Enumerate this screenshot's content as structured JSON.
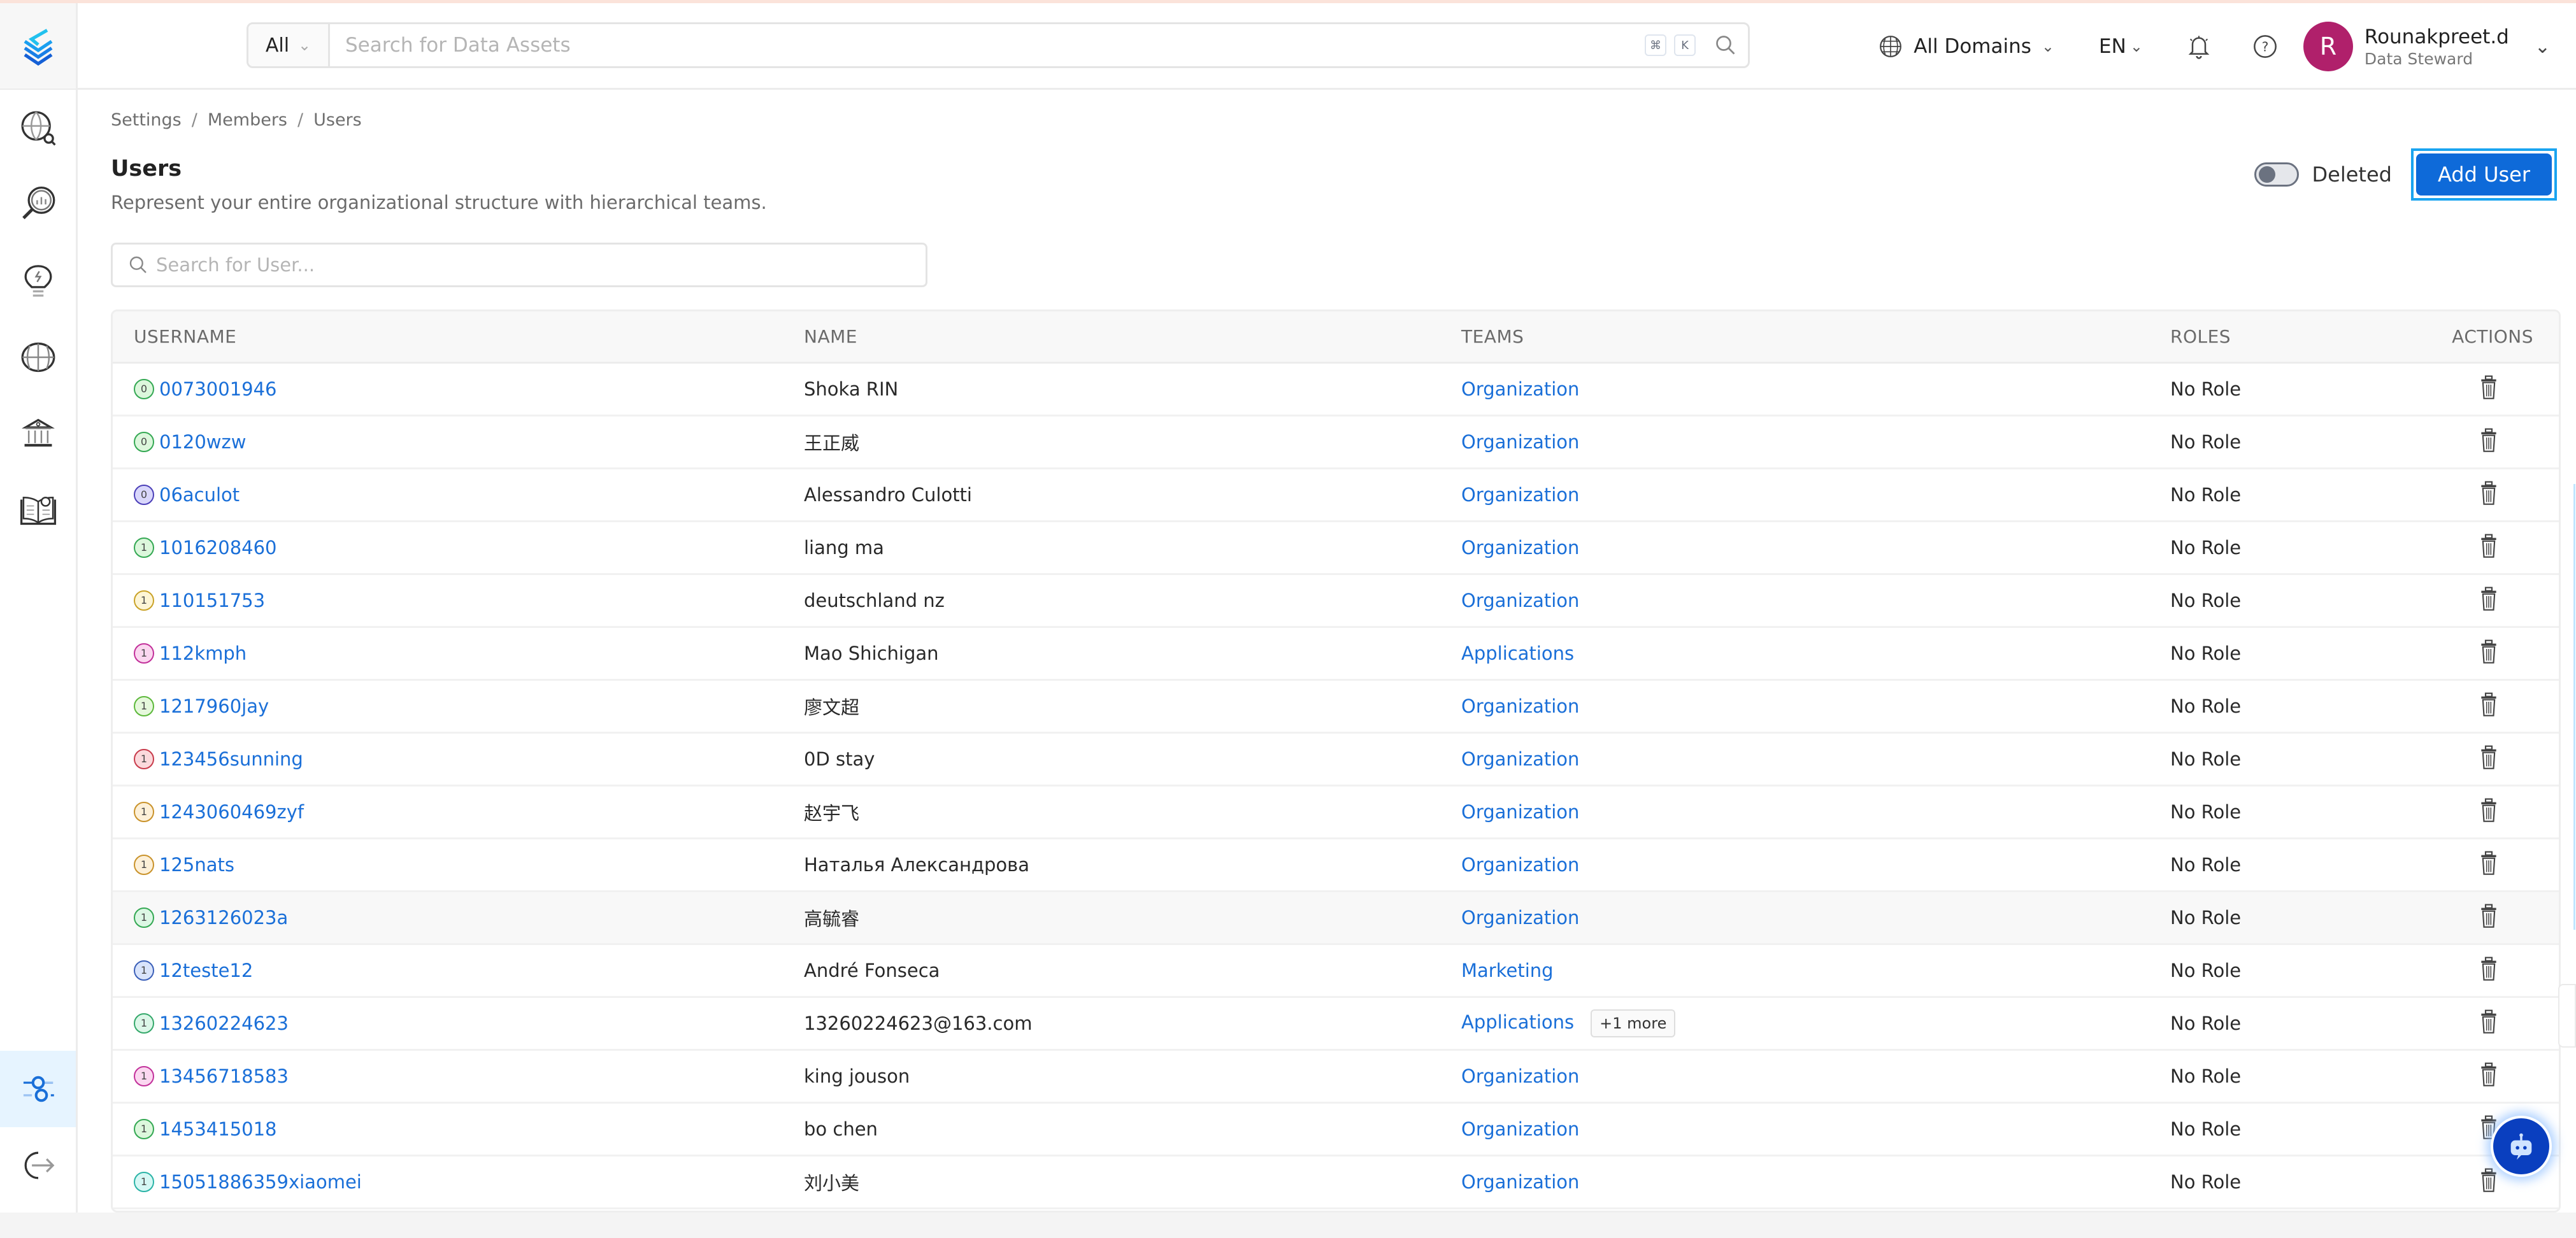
{
  "header": {
    "search_scope": "All",
    "search_placeholder": "Search for Data Assets",
    "shortcut_keys": [
      "⌘",
      "K"
    ],
    "domain_selector": "All Domains",
    "language": "EN",
    "user": {
      "initial": "R",
      "name": "Rounakpreet.d",
      "role": "Data Steward",
      "avatar_color": "#b0206b"
    }
  },
  "sidebar": {
    "items": [
      {
        "icon": "explore-icon",
        "label": "Explore"
      },
      {
        "icon": "data-insights-icon",
        "label": "Observability"
      },
      {
        "icon": "insights-lightbulb-icon",
        "label": "Insights"
      },
      {
        "icon": "domains-globe-icon",
        "label": "Domains"
      },
      {
        "icon": "governance-icon",
        "label": "Govern"
      },
      {
        "icon": "knowledge-book-icon",
        "label": "Knowledge"
      }
    ],
    "bottom_items": [
      {
        "icon": "settings-sliders-icon",
        "label": "Settings",
        "active": true
      },
      {
        "icon": "logout-icon",
        "label": "Logout"
      }
    ]
  },
  "breadcrumb": [
    "Settings",
    "Members",
    "Users"
  ],
  "page": {
    "title": "Users",
    "description": "Represent your entire organizational structure with hierarchical teams.",
    "deleted_toggle_label": "Deleted",
    "deleted_toggle_on": false,
    "add_button": "Add User",
    "user_search_placeholder": "Search for User..."
  },
  "table": {
    "columns": [
      "USERNAME",
      "NAME",
      "TEAMS",
      "ROLES",
      "ACTIONS"
    ],
    "rows": [
      {
        "badge": "0",
        "badge_color": "#34a853",
        "badge_bg": "#dcf7dc",
        "username": "0073001946",
        "name": "Shoka RIN",
        "team": "Organization",
        "more": "",
        "role": "No Role"
      },
      {
        "badge": "0",
        "badge_color": "#34a853",
        "badge_bg": "#dcf7dc",
        "username": "0120wzw",
        "name": "王正威",
        "team": "Organization",
        "more": "",
        "role": "No Role"
      },
      {
        "badge": "0",
        "badge_color": "#4b3fb8",
        "badge_bg": "#d9d7fb",
        "username": "06aculot",
        "name": "Alessandro Culotti",
        "team": "Organization",
        "more": "",
        "role": "No Role"
      },
      {
        "badge": "1",
        "badge_color": "#34a853",
        "badge_bg": "#dcf7dc",
        "username": "1016208460",
        "name": "liang ma",
        "team": "Organization",
        "more": "",
        "role": "No Role"
      },
      {
        "badge": "1",
        "badge_color": "#c9a227",
        "badge_bg": "#fdf5d6",
        "username": "110151753",
        "name": "deutschland nz",
        "team": "Organization",
        "more": "",
        "role": "No Role"
      },
      {
        "badge": "1",
        "badge_color": "#c2309a",
        "badge_bg": "#fbd7f0",
        "username": "112kmph",
        "name": "Mao Shichigan",
        "team": "Applications",
        "more": "",
        "role": "No Role"
      },
      {
        "badge": "1",
        "badge_color": "#5cb83a",
        "badge_bg": "#e6f8dc",
        "username": "1217960jay",
        "name": "廖文超",
        "team": "Organization",
        "more": "",
        "role": "No Role"
      },
      {
        "badge": "1",
        "badge_color": "#c83b4b",
        "badge_bg": "#fbd9dc",
        "username": "123456sunning",
        "name": "0D stay",
        "team": "Organization",
        "more": "",
        "role": "No Role"
      },
      {
        "badge": "1",
        "badge_color": "#c9922a",
        "badge_bg": "#fdf0d8",
        "username": "1243060469zyf",
        "name": "赵宇飞",
        "team": "Organization",
        "more": "",
        "role": "No Role"
      },
      {
        "badge": "1",
        "badge_color": "#c9922a",
        "badge_bg": "#fdf0d8",
        "username": "125nats",
        "name": "Наталья Александрова",
        "team": "Organization",
        "more": "",
        "role": "No Role"
      },
      {
        "badge": "1",
        "badge_color": "#34a853",
        "badge_bg": "#dcf7e4",
        "username": "1263126023a",
        "name": "高毓睿",
        "team": "Organization",
        "more": "",
        "role": "No Role",
        "hover": true
      },
      {
        "badge": "1",
        "badge_color": "#3b5fb8",
        "badge_bg": "#d9e4fb",
        "username": "12teste12",
        "name": "André Fonseca",
        "team": "Marketing",
        "more": "",
        "role": "No Role"
      },
      {
        "badge": "1",
        "badge_color": "#34a86a",
        "badge_bg": "#dcf7e8",
        "username": "13260224623",
        "name": "13260224623@163.com",
        "team": "Applications",
        "more": "+1 more",
        "role": "No Role"
      },
      {
        "badge": "1",
        "badge_color": "#c2309a",
        "badge_bg": "#fbd7f0",
        "username": "13456718583",
        "name": "king jouson",
        "team": "Organization",
        "more": "",
        "role": "No Role"
      },
      {
        "badge": "1",
        "badge_color": "#34a853",
        "badge_bg": "#dcf7dc",
        "username": "1453415018",
        "name": "bo chen",
        "team": "Organization",
        "more": "",
        "role": "No Role"
      },
      {
        "badge": "1",
        "badge_color": "#2ab3a6",
        "badge_bg": "#d6f8f5",
        "username": "15051886359xiaomei",
        "name": "刘小美",
        "team": "Organization",
        "more": "",
        "role": "No Role"
      }
    ]
  },
  "colors": {
    "accent": "#0e6ad9",
    "link": "#1a6fd8",
    "active_sidebar_bg": "#e6f4ff"
  }
}
